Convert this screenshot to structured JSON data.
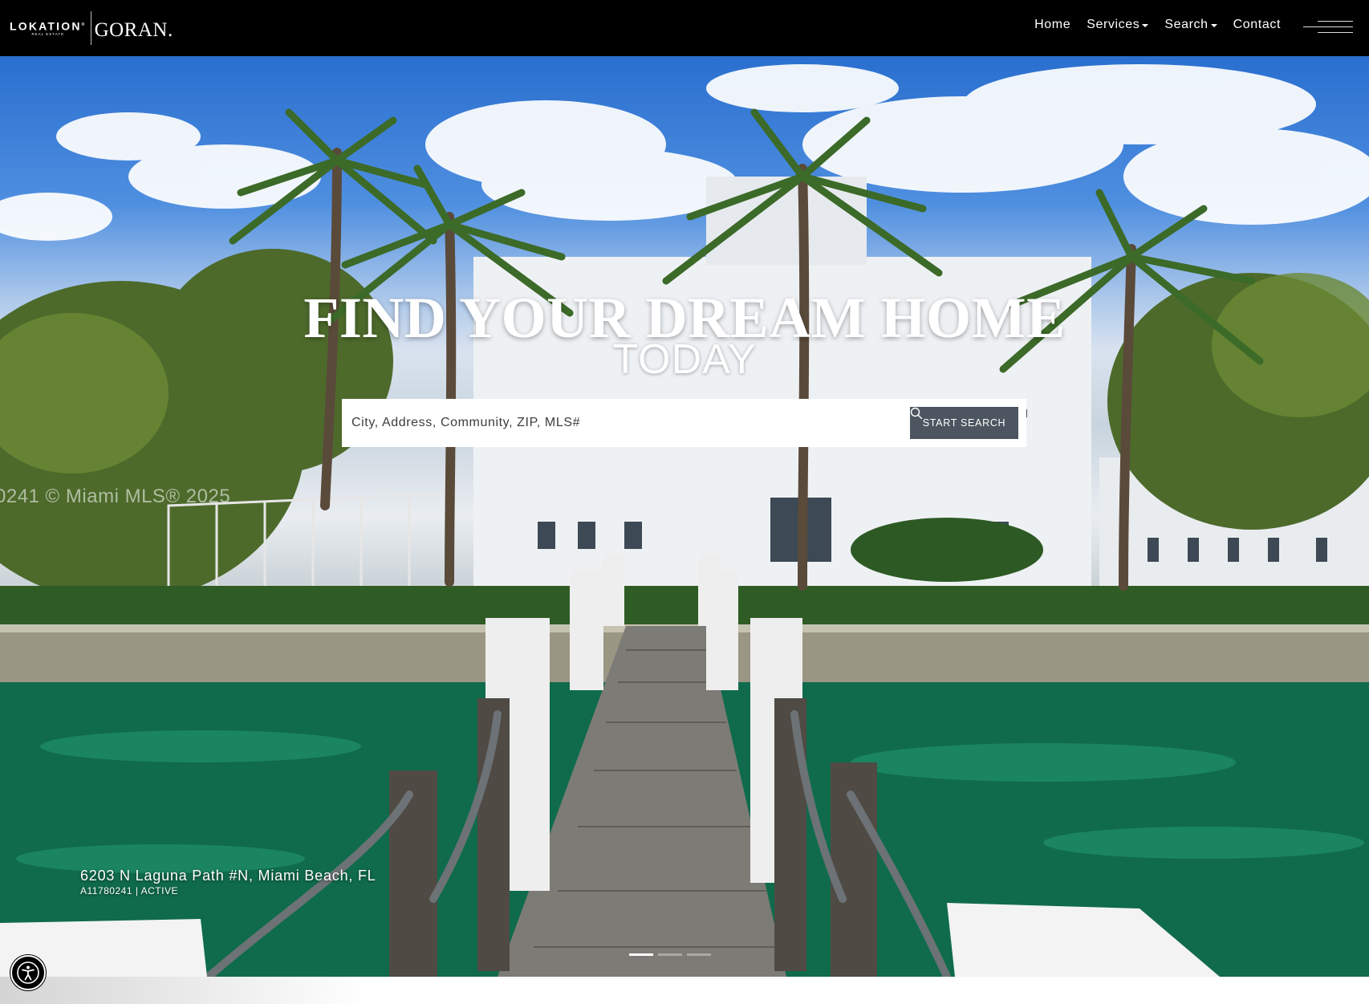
{
  "brand": {
    "primary": "LOKATION",
    "registered_mark": "®",
    "tagline": "REAL ESTATE",
    "agent": "GORAN."
  },
  "nav": {
    "items": [
      {
        "label": "Home"
      },
      {
        "label": "Services"
      },
      {
        "label": "Search"
      },
      {
        "label": "Contact"
      }
    ],
    "menu_icon": "hamburger-icon"
  },
  "hero": {
    "headline": "FIND YOUR DREAM HOME",
    "subheadline": "TODAY",
    "watermark": "0241 © Miami MLS® 2025",
    "search": {
      "placeholder": "City, Address, Community, ZIP, MLS#",
      "button_label": "START SEARCH",
      "button_icon": "search-icon"
    },
    "listing": {
      "address": "6203 N Laguna Path #N, Miami Beach, FL",
      "meta": "A11780241 | ACTIVE"
    },
    "slider": {
      "count": 3,
      "active_index": 0
    }
  },
  "accessibility": {
    "icon": "accessibility-icon"
  },
  "colors": {
    "topbar": "#000000",
    "search_button": "#4d5660",
    "text_light": "#ffffff"
  }
}
